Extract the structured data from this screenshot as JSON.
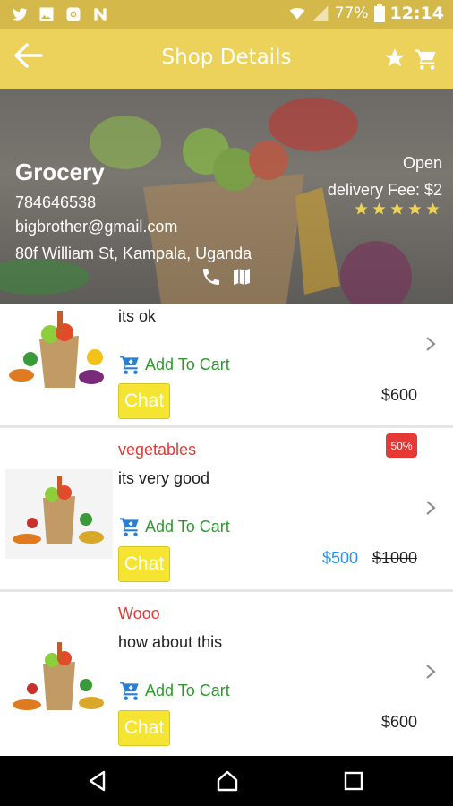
{
  "status_bar": {
    "battery": "77%",
    "time": "12:14",
    "icons": [
      "twitter-icon",
      "image-icon",
      "instagram-icon",
      "n-app-icon",
      "wifi-icon",
      "signal-icon",
      "battery-icon"
    ]
  },
  "toolbar": {
    "title": "Shop Details",
    "icons": [
      "back-arrow-icon",
      "star-icon",
      "cart-icon"
    ]
  },
  "shop": {
    "name": "Grocery",
    "phone": "784646538",
    "email": "bigbrother@gmail.com",
    "address": "80f William St, Kampala, Uganda",
    "status": "Open",
    "delivery_fee": "delivery Fee: $2",
    "rating": 5,
    "rating_color": "#ecd15a"
  },
  "products": [
    {
      "category": "",
      "description": "its ok",
      "add_label": "Add To Cart",
      "chat_label": "Chat",
      "price": "$600"
    },
    {
      "category": "vegetables",
      "description": "its very good",
      "add_label": "Add To Cart",
      "chat_label": "Chat",
      "badge": "50%",
      "sale_price": "$500",
      "old_price": "$1000"
    },
    {
      "category": "Wooo",
      "description": "how about this",
      "add_label": "Add To Cart",
      "chat_label": "Chat",
      "price": "$600"
    }
  ],
  "colors": {
    "accent": "#ecd15a",
    "chat_button": "#f5e532",
    "add_to_cart": "#2e9a2e",
    "category": "#e53935",
    "sale_price": "#2196f3"
  }
}
